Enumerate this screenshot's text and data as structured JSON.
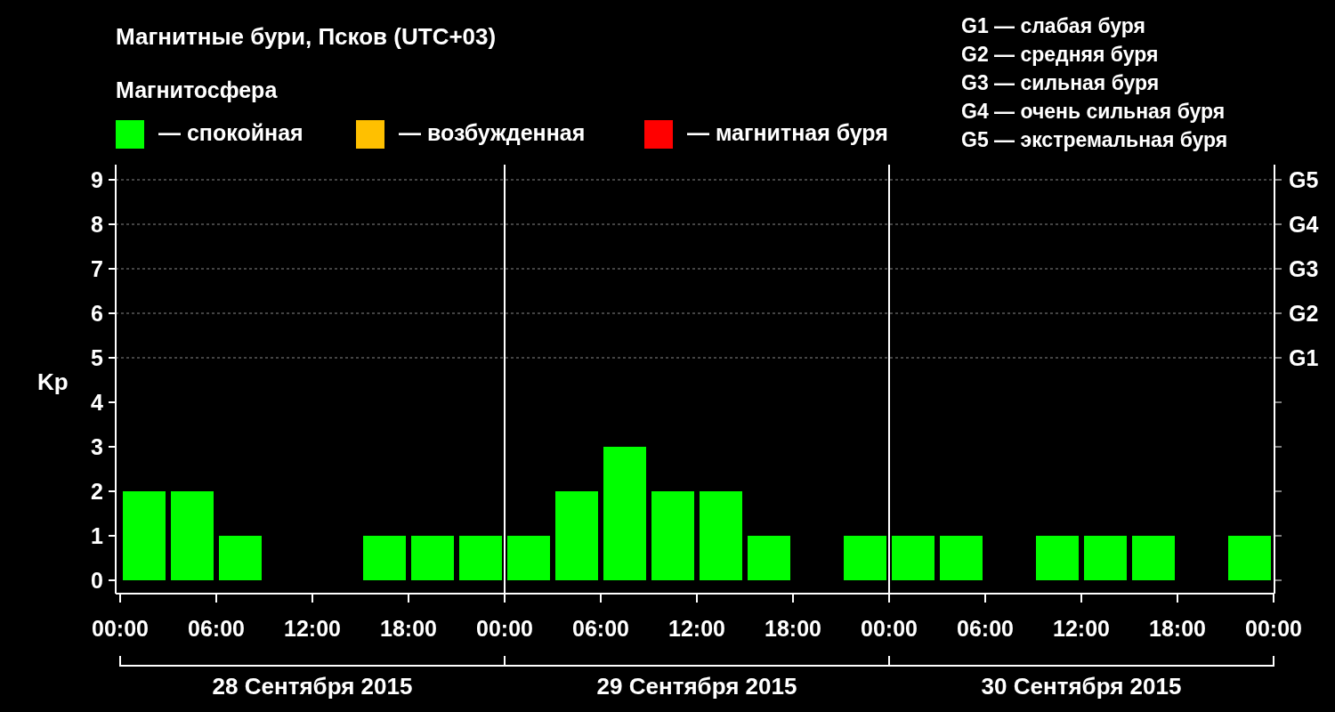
{
  "title": "Магнитные бури, Псков (UTC+03)",
  "legend": {
    "title": "Магнитосфера",
    "items": [
      {
        "label": "— спокойная",
        "color": "#00ff00"
      },
      {
        "label": "— возбужденная",
        "color": "#ffc000"
      },
      {
        "label": "— магнитная буря",
        "color": "#ff0000"
      }
    ]
  },
  "scale": [
    "G1 — слабая буря",
    "G2 — средняя буря",
    "G3 — сильная буря",
    "G4 — очень сильная буря",
    "G5 — экстремальная буря"
  ],
  "chart_data": {
    "type": "bar",
    "ylabel": "Kp",
    "categories": [
      null,
      null,
      null,
      null,
      null,
      null,
      null,
      null,
      null,
      null,
      null,
      null,
      null,
      null,
      null,
      null,
      null,
      null,
      null,
      null,
      null,
      null,
      null,
      null
    ],
    "series": [
      {
        "color": "#00ff00",
        "values": [
          2,
          2,
          1,
          0,
          0,
          1,
          1,
          1,
          1,
          2,
          3,
          2,
          2,
          1,
          0,
          1,
          1,
          1,
          0,
          1,
          1,
          1,
          0,
          1
        ]
      }
    ],
    "ylim": [
      -0.3,
      9.34
    ],
    "grid": true,
    "yticks": [
      0,
      1,
      2,
      3,
      4,
      5,
      6,
      7,
      8,
      9
    ]
  },
  "time_labels": [
    "00:00",
    "06:00",
    "12:00",
    "18:00",
    "00:00",
    "06:00",
    "12:00",
    "18:00",
    "00:00",
    "06:00",
    "12:00",
    "18:00",
    "00:00"
  ],
  "storm_axis": [
    "G5",
    "G4",
    "G3",
    "G2",
    "G1"
  ],
  "dates": [
    "28 Сентября 2015",
    "29 Сентября 2015",
    "30 Сентября 2015"
  ]
}
